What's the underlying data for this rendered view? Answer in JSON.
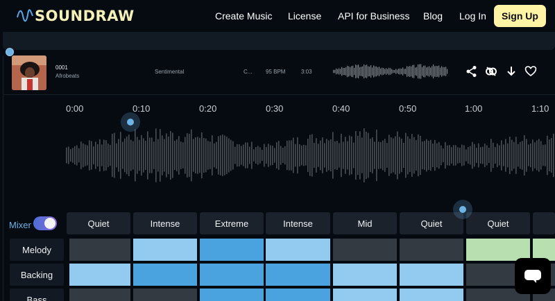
{
  "brand": {
    "name": "SOUNDRAW"
  },
  "nav": {
    "links": [
      "Create Music",
      "License",
      "API for Business",
      "Blog",
      "Log In"
    ],
    "signup": "Sign Up"
  },
  "track": {
    "id": "0001",
    "genre": "Afrobeats",
    "mood": "Sentimental",
    "theme": "C...",
    "bpm": "95 BPM",
    "length": "3:03"
  },
  "timeline": {
    "ticks": [
      "0:00",
      "0:10",
      "0:20",
      "0:30",
      "0:40",
      "0:50",
      "1:00",
      "1:10"
    ]
  },
  "mixer": {
    "label": "Mixer",
    "enabled": true,
    "energy": [
      "Quiet",
      "Intense",
      "Extreme",
      "Intense",
      "Mid",
      "Quiet",
      "Quiet"
    ],
    "rows": [
      {
        "label": "Melody",
        "levels": [
          "off",
          "light",
          "mid",
          "light",
          "off",
          "off",
          "green",
          "green"
        ]
      },
      {
        "label": "Backing",
        "levels": [
          "light",
          "mid",
          "mid",
          "mid",
          "light",
          "light",
          "off",
          "off"
        ]
      },
      {
        "label": "Bass",
        "levels": [
          "off",
          "off",
          "mid",
          "mid",
          "light",
          "light",
          "off",
          "off"
        ]
      }
    ]
  },
  "colors": {
    "off": "#333a42",
    "light": "#93caf0",
    "mid": "#4aa3de",
    "green": "#b8dfb0",
    "accent": "#6db3e3",
    "signup": "#fff3a6"
  },
  "icons": [
    "share-icon",
    "link-icon",
    "download-icon",
    "heart-icon",
    "chat-icon"
  ]
}
